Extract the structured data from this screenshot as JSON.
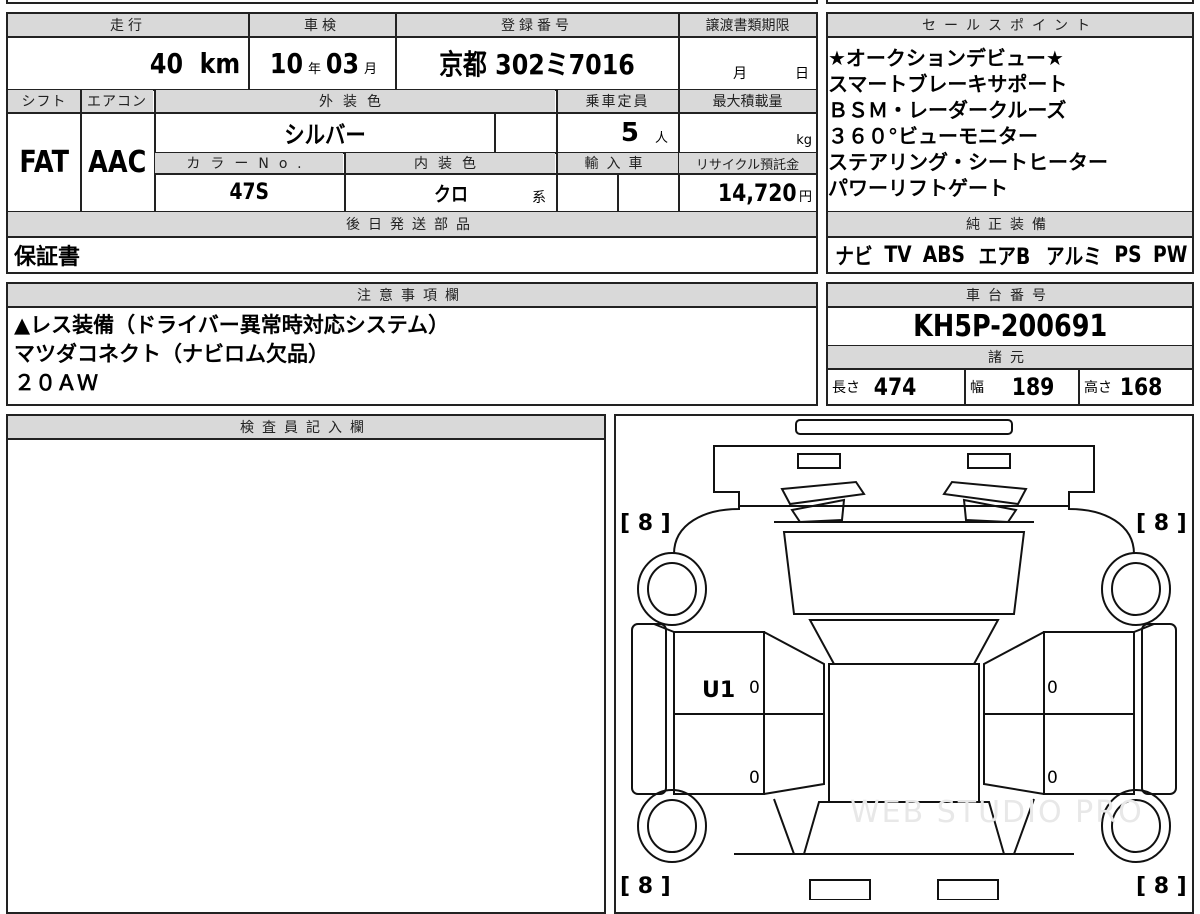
{
  "vehicle": {
    "mileage_header": "走行",
    "mileage_value": "40",
    "mileage_unit": "km",
    "inspection_header": "車検",
    "inspection_year": "10",
    "inspection_year_unit": "年",
    "inspection_month": "03",
    "inspection_month_unit": "月",
    "registration_header": "登録番号",
    "registration_number": "京都 302ミ7016",
    "transfer_deadline_header": "譲渡書類期限",
    "transfer_month_unit": "月",
    "transfer_day_unit": "日",
    "shift_header": "シフト",
    "shift_value": "FAT",
    "aircon_header": "エアコン",
    "aircon_value": "AAC",
    "exterior_color_header": "外装色",
    "exterior_color_value": "シルバー",
    "capacity_header": "乗車定員",
    "capacity_value": "5",
    "capacity_unit": "人",
    "max_load_header": "最大積載量",
    "max_load_unit": "kg",
    "color_no_header": "カラーNo.",
    "color_no_value": "47S",
    "interior_color_header": "内装色",
    "interior_color_value": "クロ",
    "interior_color_suffix": "系",
    "import_header": "輸入車",
    "recycle_header": "リサイクル預託金",
    "recycle_value": "14,720",
    "recycle_unit": "円"
  },
  "later_parts": {
    "header": "後日発送部品",
    "value": "保証書"
  },
  "sales_points": {
    "header": "セールスポイント",
    "lines": [
      "★オークションデビュー★",
      "スマートブレーキサポート",
      "ＢＳＭ・レーダークルーズ",
      "３６０°ビューモニター",
      "ステアリング・シートヒーター",
      "パワーリフトゲート"
    ]
  },
  "genuine_equipment": {
    "header": "純正装備",
    "items": [
      "ナビ",
      "TV",
      "ABS",
      "エアB",
      "アルミ",
      "PS",
      "PW"
    ]
  },
  "notes": {
    "header": "注意事項欄",
    "lines": [
      "▲レス装備（ドライバー異常時対応システム）",
      "マツダコネクト（ナビロム欠品）",
      "２０ＡＷ"
    ]
  },
  "chassis": {
    "header": "車台番号",
    "number": "KH5P-200691"
  },
  "specs": {
    "header": "諸元",
    "length_label": "長さ",
    "length_value": "474",
    "width_label": "幅",
    "width_value": "189",
    "height_label": "高さ",
    "height_value": "168"
  },
  "inspector": {
    "header": "検査員記入欄"
  },
  "diagram": {
    "tread_fl": "[ 8 ]",
    "tread_fr": "[ 8 ]",
    "tread_rl": "[ 8 ]",
    "tread_rr": "[ 8 ]",
    "damage_mark": "U1",
    "panel_marks": [
      "0",
      "0",
      "0",
      "0"
    ],
    "watermark": "WEB STUDIO PRO"
  }
}
